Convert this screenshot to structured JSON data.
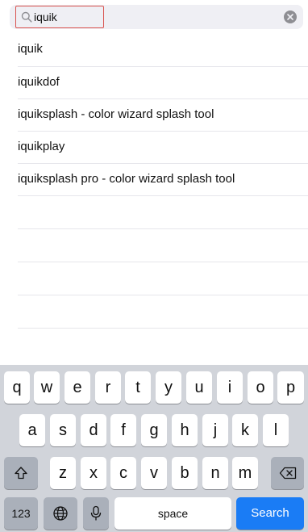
{
  "search": {
    "value": "iquik",
    "placeholder": "",
    "icon": "search-icon",
    "clear_icon": "clear-icon"
  },
  "suggestions": [
    "iquik",
    "iquikdof",
    "iquiksplash - color wizard splash tool",
    "iquikplay",
    "iquiksplash pro - color wizard splash tool"
  ],
  "keyboard": {
    "row1": [
      "q",
      "w",
      "e",
      "r",
      "t",
      "y",
      "u",
      "i",
      "o",
      "p"
    ],
    "row2": [
      "a",
      "s",
      "d",
      "f",
      "g",
      "h",
      "j",
      "k",
      "l"
    ],
    "row3": [
      "z",
      "x",
      "c",
      "v",
      "b",
      "n",
      "m"
    ],
    "numbers_label": "123",
    "space_label": "space",
    "search_label": "Search"
  },
  "colors": {
    "highlight_border": "#d9534f",
    "search_key": "#1a7cf5",
    "keyboard_bg": "#d1d4da"
  }
}
